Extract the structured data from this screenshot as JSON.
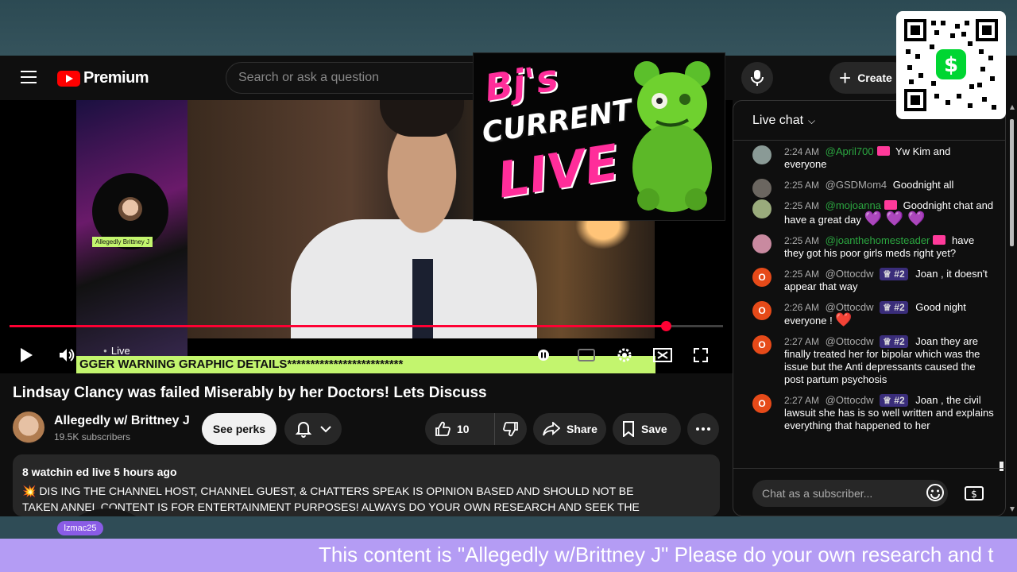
{
  "masthead": {
    "logo_text": "Premium",
    "search_placeholder": "Search or ask a question",
    "create_label": "Create"
  },
  "overlay": {
    "line1": "Bj's",
    "line2": "CURRENT",
    "line3": "LIVE"
  },
  "player": {
    "live_label": "Live",
    "banner_text": "GGER WARNING GRAPHIC DETAILS*************************",
    "side_tag": "Allegedly Brittney J",
    "progress_fraction": 0.92
  },
  "video": {
    "title": "Lindsay Clancy was failed Miserably by her Doctors! Lets Discuss",
    "channel_name": "Allegedly w/ Brittney J",
    "subscribers": "19.5K subscribers",
    "perks_label": "See perks",
    "like_count": "10",
    "share_label": "Share",
    "save_label": "Save"
  },
  "description": {
    "meta": "8 watchin           ed live 5 hours ago",
    "line1": "💥 DIS                   ING THE CHANNEL HOST, CHANNEL GUEST, & CHATTERS SPEAK IS OPINION BASED AND SHOULD NOT BE",
    "line2": "TAKEN                   ANNEL CONTENT IS FOR ENTERTAINMENT PURPOSES!  ALWAYS DO YOUR OWN RESEARCH AND SEEK THE"
  },
  "camera": {
    "tag": "lzmac25"
  },
  "chat": {
    "title": "Live chat",
    "input_placeholder": "Chat as a subscriber...",
    "messages": [
      {
        "time": "2:24 AM",
        "user": "@April700",
        "member": true,
        "rank": "",
        "text": "Yw Kim and everyone",
        "heart": ""
      },
      {
        "time": "2:25 AM",
        "user": "@GSDMom4",
        "member": false,
        "rank": "",
        "text": "Goodnight all",
        "heart": ""
      },
      {
        "time": "2:25 AM",
        "user": "@mojoanna",
        "member": true,
        "rank": "",
        "text": "Goodnight chat and have a great day",
        "heart": "💜 💜 💜"
      },
      {
        "time": "2:25 AM",
        "user": "@joanthehomesteader",
        "member": true,
        "rank": "",
        "text": "have they got his poor girls meds right yet?",
        "heart": ""
      },
      {
        "time": "2:25 AM",
        "user": "@Ottocdw",
        "member": false,
        "rank": "#2",
        "text": "Joan , it doesn't appear that way",
        "heart": ""
      },
      {
        "time": "2:26 AM",
        "user": "@Ottocdw",
        "member": false,
        "rank": "#2",
        "text": "Good night everyone !",
        "heart": "❤️"
      },
      {
        "time": "2:27 AM",
        "user": "@Ottocdw",
        "member": false,
        "rank": "#2",
        "text": "Joan they are finally treated her for bipolar which was the issue but the Anti depressants caused the post partum psychosis",
        "heart": ""
      },
      {
        "time": "2:27 AM",
        "user": "@Ottocdw",
        "member": false,
        "rank": "#2",
        "text": "Joan , the civil lawsuit she has is so well written and explains everything that happened to her",
        "heart": ""
      }
    ]
  },
  "ticker": {
    "text": "This content is \"Allegedly w/Brittney J\" Please do your own research and t"
  },
  "colors": {
    "accent_red": "#ff0033",
    "member_green": "#2ba640",
    "ticker_purple": "#b49cf4",
    "banner_lime": "#c3f56e"
  }
}
